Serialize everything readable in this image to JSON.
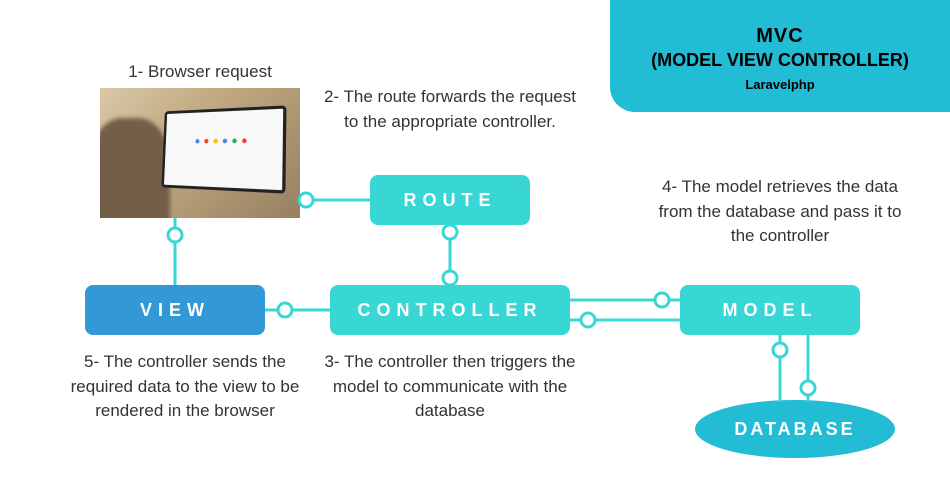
{
  "header": {
    "title": "MVC",
    "subtitle": "(MODEL VIEW CONTROLLER)",
    "brand": "Laravelphp"
  },
  "steps": {
    "s1": "1- Browser request",
    "s2": "2- The route forwards the request to the appropriate controller.",
    "s3": "3- The controller then triggers the model to communicate with the database",
    "s4": "4- The model retrieves the data from the database and pass it to the controller",
    "s5": "5- The controller sends the required data to the view to be rendered in the browser"
  },
  "nodes": {
    "route": "ROUTE",
    "controller": "CONTROLLER",
    "model": "MODEL",
    "view": "VIEW",
    "database": "DATABASE"
  },
  "colors": {
    "teal": "#39d6d6",
    "blue": "#3399d6",
    "headerTeal": "#23bcd5"
  }
}
